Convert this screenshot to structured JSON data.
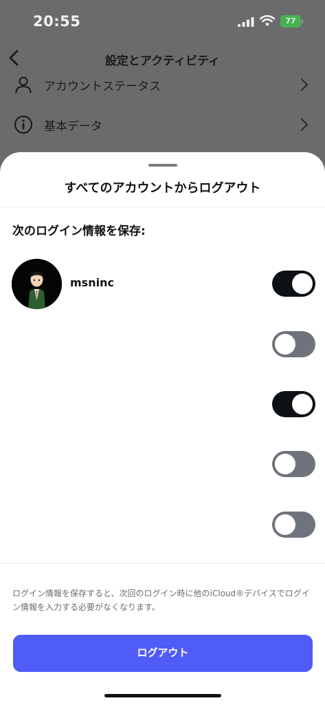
{
  "status_bar": {
    "time": "20:55",
    "battery": "77"
  },
  "nav": {
    "title": "設定とアクティビティ"
  },
  "background_rows": [
    {
      "label": "アカウントステータス",
      "icon": "person-icon"
    },
    {
      "label": "基本データ",
      "icon": "info-icon"
    }
  ],
  "sheet": {
    "title": "すべてのアカウントからログアウト",
    "section_title": "次のログイン情報を保存:",
    "account": {
      "username": "msninc"
    },
    "toggles": [
      {
        "state": "on"
      },
      {
        "state": "off"
      },
      {
        "state": "on"
      },
      {
        "state": "off"
      },
      {
        "state": "off"
      }
    ],
    "footer_note": "ログイン情報を保存すると、次回のログイン時に他のiCloud®デバイスでログイン情報を入力する必要がなくなります。",
    "logout_label": "ログアウト"
  },
  "colors": {
    "accent": "#4f5cf7",
    "toggle_on": "#0d1116",
    "toggle_off": "#6e737c",
    "battery": "#3ec14f"
  }
}
